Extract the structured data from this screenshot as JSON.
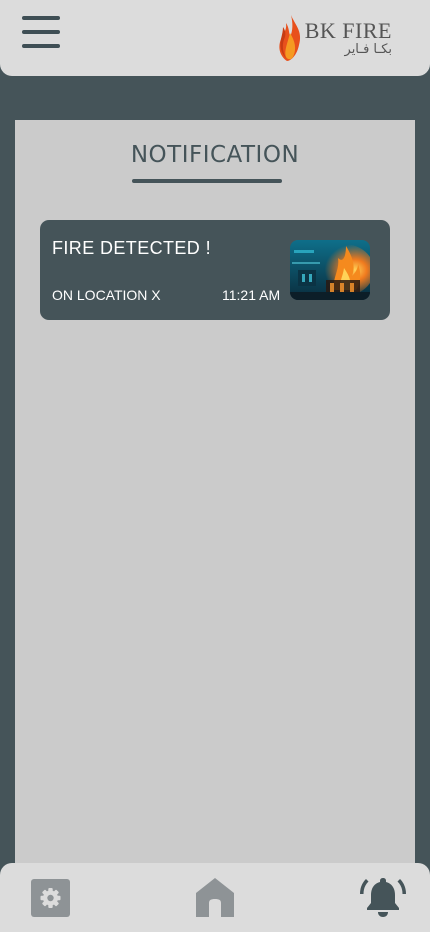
{
  "header": {
    "menu_icon": "hamburger-menu-icon",
    "logo": {
      "name_en": "BK FIRE",
      "name_ar": "بكـا فـاير",
      "flame_colors": [
        "#e8501c",
        "#f59a22"
      ]
    }
  },
  "notifications": {
    "title": "NOTIFICATION",
    "items": [
      {
        "title": "FIRE DETECTED !",
        "location": "ON LOCATION X",
        "time": "11:21 AM",
        "thumbnail": "fire-scene-image"
      }
    ]
  },
  "bottom_nav": {
    "items": [
      {
        "icon": "gear-icon"
      },
      {
        "icon": "home-icon"
      },
      {
        "icon": "bell-icon"
      }
    ]
  },
  "colors": {
    "background": "#455459",
    "bars": "#dcdcdc",
    "panel": "#cbcbcb",
    "card": "#455459",
    "muted_icon": "#8e9396"
  }
}
